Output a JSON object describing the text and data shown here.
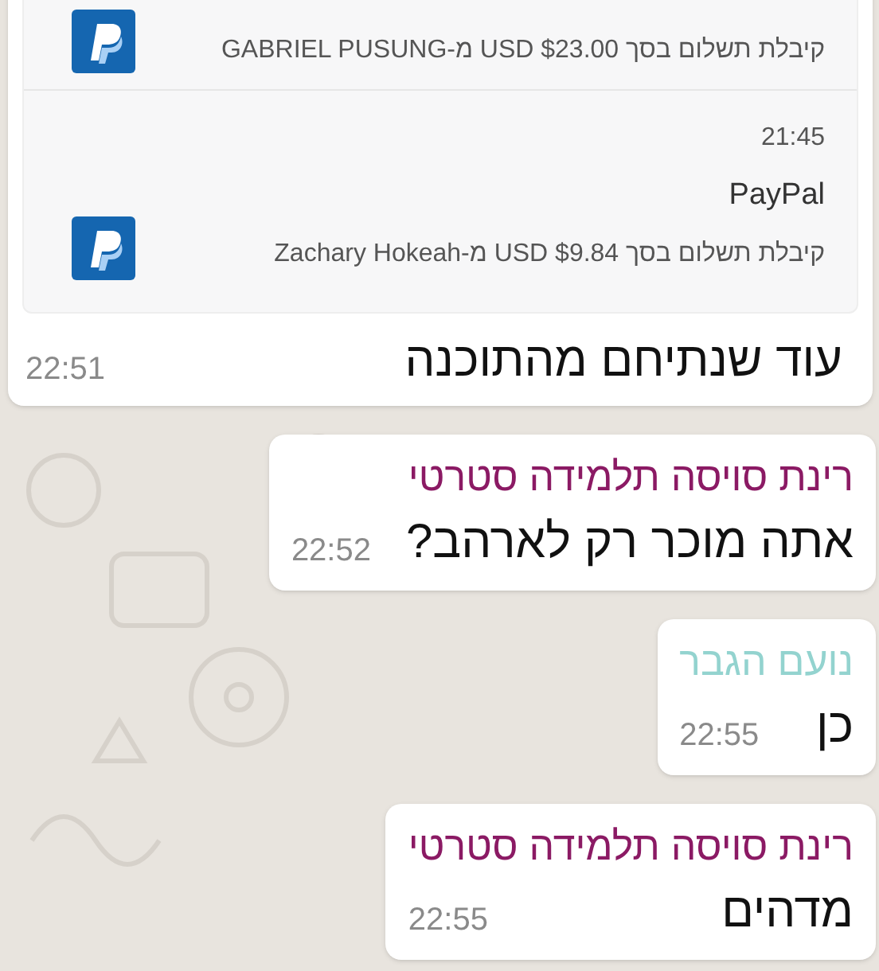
{
  "messages": [
    {
      "kind": "screenshot",
      "notifications": [
        {
          "text": "קיבלת תשלום בסך USD $23.00 מ-GABRIEL PUSUNG"
        },
        {
          "time": "21:45",
          "app": "PayPal",
          "text": "קיבלת תשלום בסך USD $9.84 מ-Zachary Hokeah"
        }
      ],
      "caption": "עוד שנתיחם מהתוכנה",
      "time": "22:51"
    },
    {
      "kind": "text",
      "sender": "רינת סויסה תלמידה סטרטי",
      "color": "#8b1a64",
      "text": "אתה מוכר רק לארהב?",
      "time": "22:52"
    },
    {
      "kind": "text",
      "sender": "נועם הגבר",
      "color": "#93d3cf",
      "text": "כן",
      "time": "22:55"
    },
    {
      "kind": "text",
      "sender": "רינת סויסה תלמידה סטרטי",
      "color": "#8b1a64",
      "text": "מדהים",
      "time": "22:55"
    }
  ]
}
